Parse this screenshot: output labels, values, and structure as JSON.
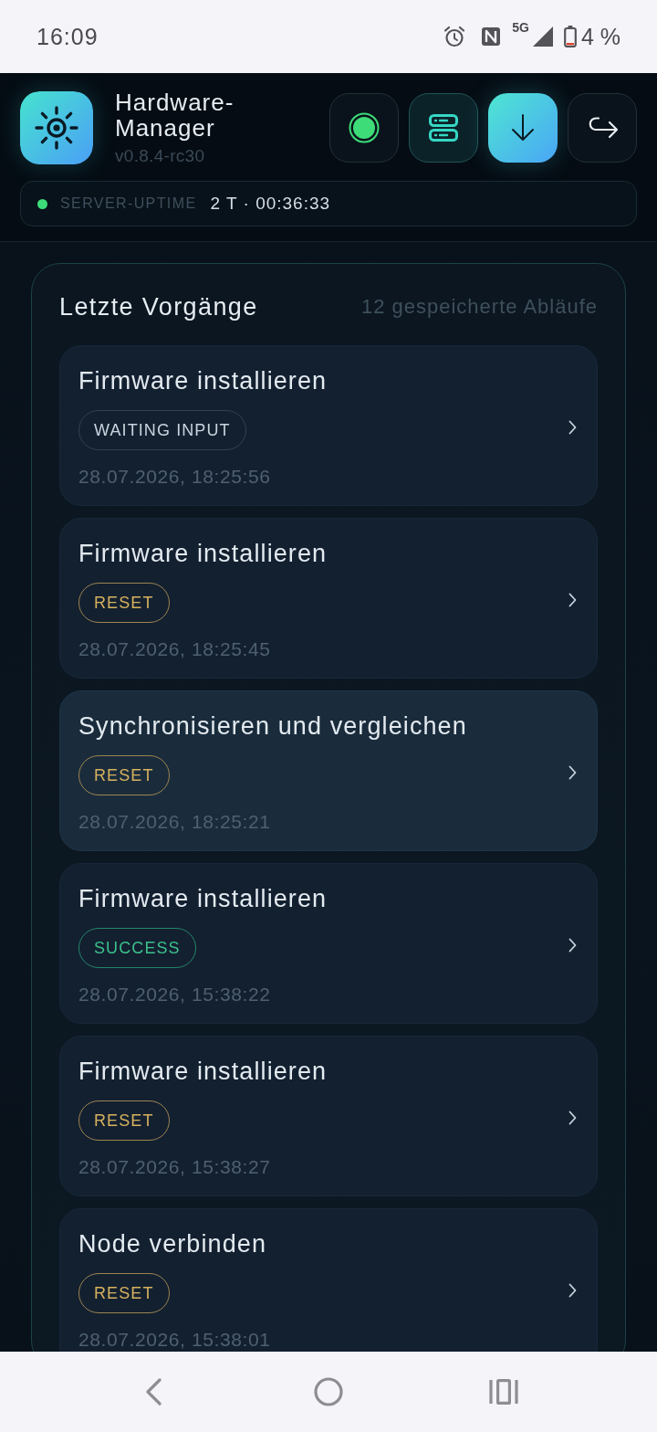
{
  "status_bar": {
    "time": "16:09",
    "indicators": [
      {
        "kind": "alarm"
      },
      {
        "kind": "nfc"
      },
      {
        "kind": "network",
        "label": "5G"
      },
      {
        "kind": "signal"
      },
      {
        "kind": "battery",
        "label": "4 %"
      }
    ]
  },
  "app": {
    "title": "Hardware-Manager",
    "version": "v0.8.4-rc30"
  },
  "toolbar": [
    {
      "kind": "status"
    },
    {
      "kind": "server"
    },
    {
      "kind": "download"
    },
    {
      "kind": "forward"
    }
  ],
  "uptime": {
    "online": true,
    "label": "SERVER-UPTIME",
    "value": "2 T · 00:36:33"
  },
  "panel": {
    "title": "Letzte Vorgänge",
    "count": "12 gespeicherte Abläufe",
    "items": [
      {
        "title": "Firmware installieren",
        "status": {
          "label": "WAITING INPUT",
          "kind": "waiting"
        },
        "time": "28.07.2026, 18:25:56",
        "selected": false
      },
      {
        "title": "Firmware installieren",
        "status": {
          "label": "RESET",
          "kind": "reset"
        },
        "time": "28.07.2026, 18:25:45",
        "selected": false
      },
      {
        "title": "Synchronisieren und vergleichen",
        "status": {
          "label": "RESET",
          "kind": "reset"
        },
        "time": "28.07.2026, 18:25:21",
        "selected": true
      },
      {
        "title": "Firmware installieren",
        "status": {
          "label": "SUCCESS",
          "kind": "success"
        },
        "time": "28.07.2026, 15:38:22",
        "selected": false
      },
      {
        "title": "Firmware installieren",
        "status": {
          "label": "RESET",
          "kind": "reset"
        },
        "time": "28.07.2026, 15:38:27",
        "selected": false
      },
      {
        "title": "Node verbinden",
        "status": {
          "label": "RESET",
          "kind": "reset"
        },
        "time": "28.07.2026, 15:38:01",
        "selected": false
      }
    ]
  },
  "nav_bar": [
    {
      "kind": "back"
    },
    {
      "kind": "home"
    },
    {
      "kind": "recents"
    }
  ]
}
